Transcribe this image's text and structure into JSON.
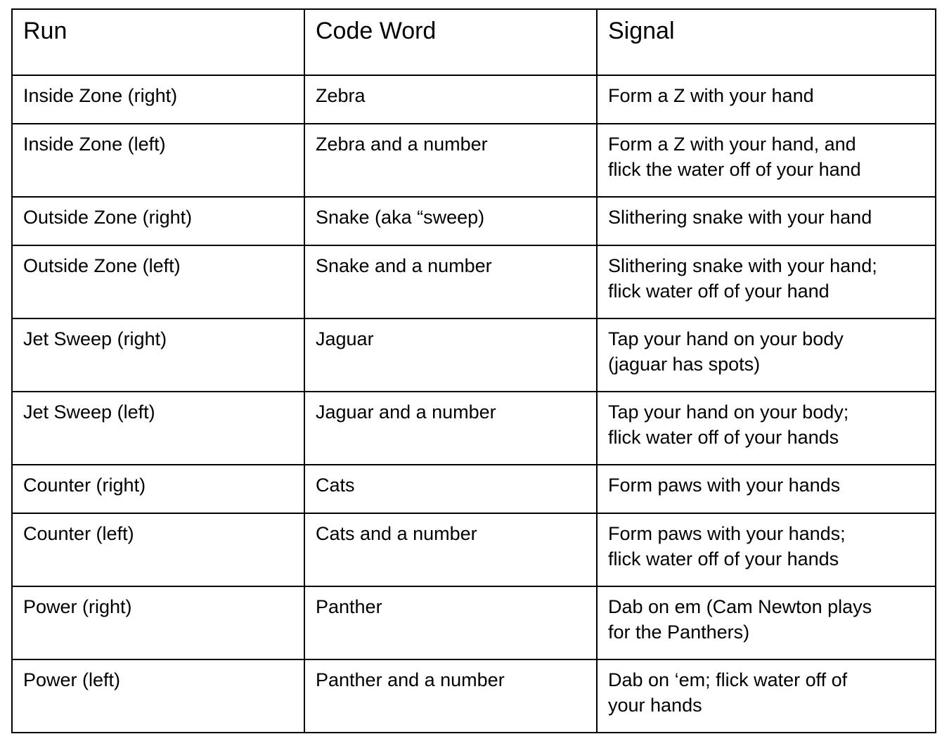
{
  "table": {
    "name": "run-signals-table",
    "columns": [
      {
        "key": "run",
        "label": "Run"
      },
      {
        "key": "code_word",
        "label": "Code Word"
      },
      {
        "key": "signal",
        "label": "Signal"
      }
    ],
    "rows": [
      {
        "run": "Inside Zone (right)",
        "code_word": "Zebra",
        "signal": "Form a Z with your hand",
        "lines": 1
      },
      {
        "run": "Inside Zone (left)",
        "code_word": "Zebra and a number",
        "signal": "Form a Z with your hand, and\nflick the water off of your hand",
        "lines": 2
      },
      {
        "run": "Outside Zone (right)",
        "code_word": "Snake (aka “sweep)",
        "signal": "Slithering snake with your hand",
        "lines": 1
      },
      {
        "run": "Outside Zone (left)",
        "code_word": "Snake and a number",
        "signal": "Slithering snake with your hand;\nflick water off of your hand",
        "lines": 2
      },
      {
        "run": "Jet Sweep (right)",
        "code_word": "Jaguar",
        "signal": "Tap your hand on your body\n(jaguar has spots)",
        "lines": 2
      },
      {
        "run": "Jet Sweep (left)",
        "code_word": "Jaguar and a number",
        "signal": "Tap your hand on your body;\nflick water off of your hands",
        "lines": 2
      },
      {
        "run": "Counter (right)",
        "code_word": "Cats",
        "signal": "Form paws with your hands",
        "lines": 1
      },
      {
        "run": "Counter (left)",
        "code_word": "Cats and a number",
        "signal": "Form paws with your hands;\nflick water off of your hands",
        "lines": 2
      },
      {
        "run": "Power (right)",
        "code_word": "Panther",
        "signal": "Dab on em (Cam Newton plays\nfor the Panthers)",
        "lines": 2
      },
      {
        "run": "Power (left)",
        "code_word": "Panther and a number",
        "signal": "Dab on ‘em; flick water off of\nyour hands",
        "lines": 2
      }
    ]
  },
  "colors": {
    "border": "#000000",
    "text": "#000000",
    "background": "#ffffff"
  }
}
